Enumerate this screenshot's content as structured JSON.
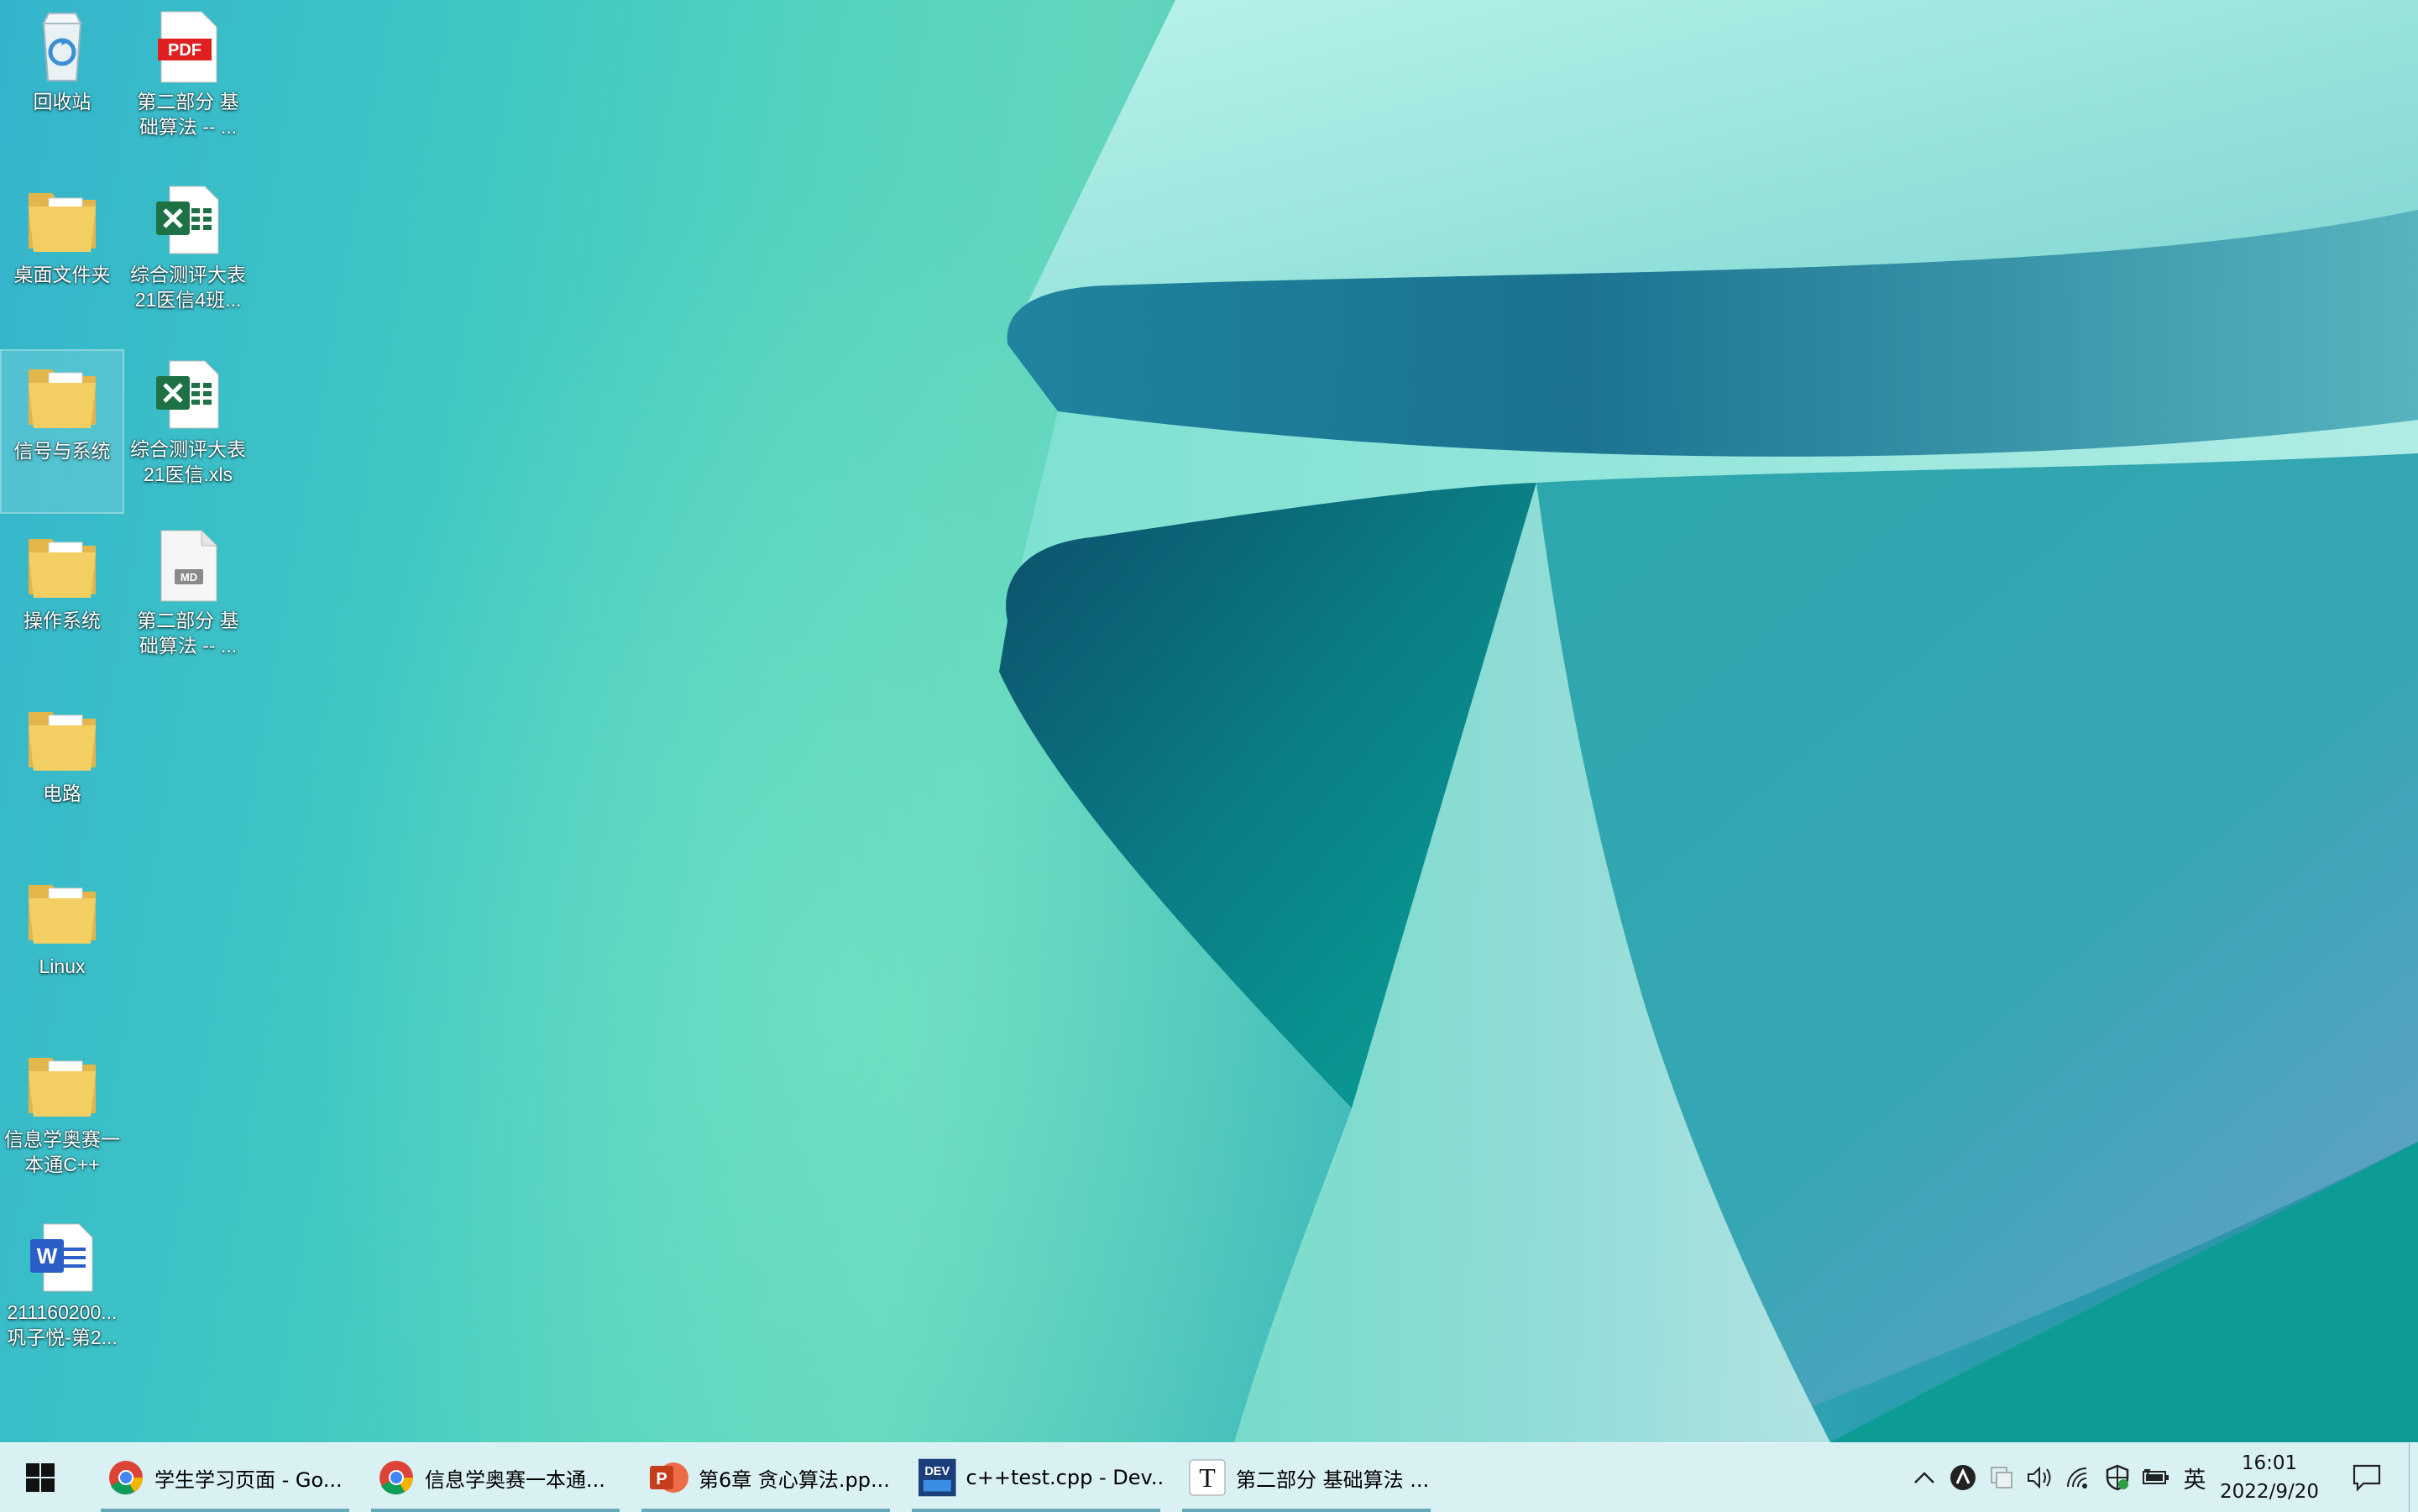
{
  "desktop": {
    "icons": [
      {
        "label": "回收站",
        "type": "recycle-bin"
      },
      {
        "label": "第二部分 基\n础算法 -- ...",
        "type": "pdf"
      },
      {
        "label": "桌面文件夹",
        "type": "folder"
      },
      {
        "label": "综合测评大表\n21医信4班...",
        "type": "excel"
      },
      {
        "label": "信号与系统",
        "type": "folder"
      },
      {
        "label": "综合测评大表\n21医信.xls",
        "type": "excel"
      },
      {
        "label": "操作系统",
        "type": "folder"
      },
      {
        "label": "第二部分 基\n础算法 -- ...",
        "type": "md-file"
      },
      {
        "label": "电路",
        "type": "folder"
      },
      {
        "label": "Linux",
        "type": "folder"
      },
      {
        "label": "信息学奥赛一\n本通C++",
        "type": "folder"
      },
      {
        "label": "211160200...\n巩子悦-第2...",
        "type": "word"
      }
    ],
    "pdf_badge": "PDF",
    "word_badge": "W",
    "md_badge": "MD"
  },
  "taskbar": {
    "tasks": [
      {
        "label": "学生学习页面 - Go...",
        "icon": "chrome-icon"
      },
      {
        "label": "信息学奥赛一本通...",
        "icon": "chrome-icon"
      },
      {
        "label": "第6章  贪心算法.pp...",
        "icon": "powerpoint-icon"
      },
      {
        "label": "c++test.cpp - Dev...",
        "icon": "devcpp-icon"
      },
      {
        "label": "第二部分 基础算法 ...",
        "icon": "typora-icon"
      }
    ],
    "ppt_badge": "P",
    "dev_badge": "DEV",
    "typora_badge": "T",
    "ime": "英",
    "time": "16:01",
    "date": "2022/9/20"
  },
  "colors": {
    "taskbar_bg": "#d7f0f3",
    "active_indicator": "#66a9b8",
    "folder": "#f3cf63",
    "pdf_red": "#e02020",
    "excel_green": "#1e7145",
    "word_blue": "#2b5fc7"
  }
}
